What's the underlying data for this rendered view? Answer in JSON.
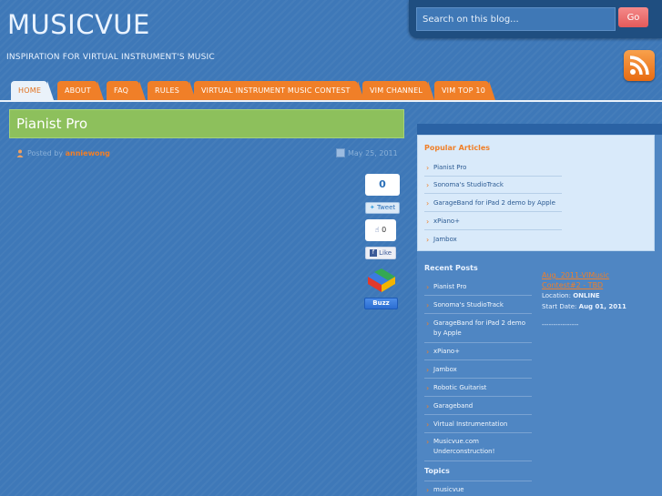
{
  "site": {
    "title": "MUSICVUE",
    "tagline": "INSPIRATION FOR VIRTUAL INSTRUMENT'S MUSIC"
  },
  "search": {
    "placeholder": "Search on this blog...",
    "go_label": "Go"
  },
  "nav": {
    "tabs": [
      {
        "label": "HOME",
        "active": true
      },
      {
        "label": "ABOUT"
      },
      {
        "label": "FAQ"
      },
      {
        "label": "RULES"
      },
      {
        "label": "VIRTUAL INSTRUMENT MUSIC CONTEST"
      },
      {
        "label": "VIM CHANNEL"
      },
      {
        "label": "VIM TOP 10"
      }
    ]
  },
  "post": {
    "title": "Pianist Pro",
    "posted_by_label": "Posted by",
    "author": "anniewong",
    "date": "May 25, 2011"
  },
  "share": {
    "tweet_count": "0",
    "tweet_label": "Tweet",
    "like_count": "0",
    "like_label": "Like",
    "buzz_label": "Buzz"
  },
  "sidebar": {
    "popular": {
      "heading": "Popular Articles",
      "items": [
        "Pianist Pro",
        "Sonoma's StudioTrack",
        "GarageBand for iPad 2 demo by Apple",
        "xPiano+",
        "Jambox"
      ]
    },
    "recent": {
      "heading": "Recent Posts",
      "items": [
        "Pianist Pro",
        "Sonoma's StudioTrack",
        "GarageBand for iPad 2 demo by Apple",
        "xPiano+",
        "Jambox",
        "Robotic Guitarist",
        "Garageband",
        "Virtual Instrumentation",
        "Musicvue.com Underconstruction!"
      ]
    },
    "topics": {
      "heading": "Topics",
      "items": [
        "musicvue"
      ]
    },
    "contest": {
      "link": "Aug. 2011-VIMusic Contest#2 - TBD",
      "location_label": "Location:",
      "location": "ONLINE",
      "start_label": "Start Date:",
      "start_date": "Aug 01, 2011",
      "divider": "----------------"
    }
  },
  "colors": {
    "background": "#3e78b8",
    "accent_orange": "#f07f28",
    "title_green": "#8dc05c",
    "go_red": "#e35a5a"
  }
}
